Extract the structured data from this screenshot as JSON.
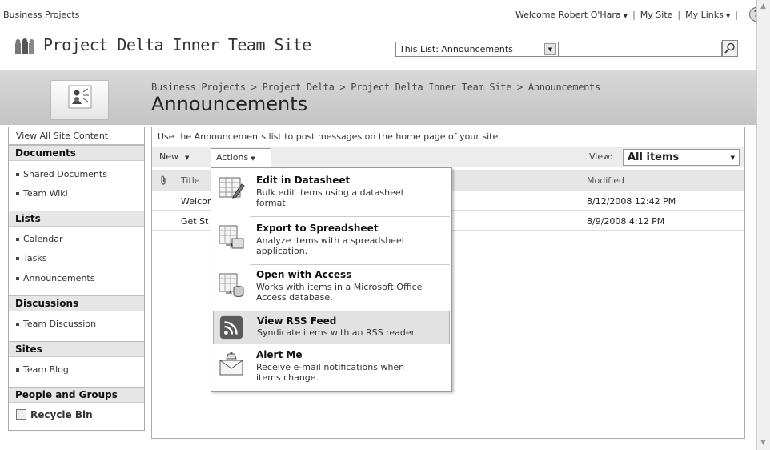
{
  "topbar": {
    "site_crumb": "Business Projects",
    "welcome": "Welcome Robert O'Hara",
    "my_site": "My Site",
    "my_links": "My Links",
    "sep": "|",
    "help": "?"
  },
  "site": {
    "title": "Project Delta Inner Team Site"
  },
  "search": {
    "scope": "This List: Announcements",
    "value": ""
  },
  "page": {
    "breadcrumb": "Business Projects > Project Delta > Project Delta Inner Team Site > Announcements",
    "title": "Announcements",
    "description": "Use the Announcements list to post messages on the home page of your site."
  },
  "quicklaunch": {
    "view_all": "View All Site Content",
    "documents_head": "Documents",
    "shared_documents": "Shared Documents",
    "team_wiki": "Team Wiki",
    "lists_head": "Lists",
    "calendar": "Calendar",
    "tasks": "Tasks",
    "announcements": "Announcements",
    "discussions_head": "Discussions",
    "team_discussion": "Team Discussion",
    "sites_head": "Sites",
    "team_blog": "Team Blog",
    "people_head": "People and Groups",
    "recycle_bin": "Recycle Bin"
  },
  "toolbar": {
    "new_label": "New",
    "actions_label": "Actions",
    "view_label": "View:",
    "view_value": "All items"
  },
  "list": {
    "col_title": "Title",
    "col_modified": "Modified",
    "rows": [
      {
        "title": "Welcor",
        "modified": "8/12/2008 12:42 PM"
      },
      {
        "title": "Get St",
        "modified": "8/9/2008 4:12 PM"
      }
    ]
  },
  "actions_menu": {
    "edit_title": "Edit in Datasheet",
    "edit_desc_1": "Bulk edit items using a datasheet",
    "edit_desc_2": "format.",
    "export_title": "Export to Spreadsheet",
    "export_desc_1": "Analyze items with a spreadsheet",
    "export_desc_2": "application.",
    "access_title": "Open with Access",
    "access_desc_1": "Works with items in a Microsoft Office",
    "access_desc_2": "Access database.",
    "rss_title": "View RSS Feed",
    "rss_desc_1": "Syndicate items with an RSS reader.",
    "alert_title": "Alert Me",
    "alert_desc_1": "Receive e-mail notifications when",
    "alert_desc_2": "items change."
  },
  "icons": {
    "help": "help-icon",
    "search": "magnifier-icon",
    "rss": "rss-icon",
    "recycle": "recycle-bin-icon"
  },
  "colors": {
    "rss_orange": "#5a5a5a",
    "menu_highlight": "#e2e2e2"
  }
}
